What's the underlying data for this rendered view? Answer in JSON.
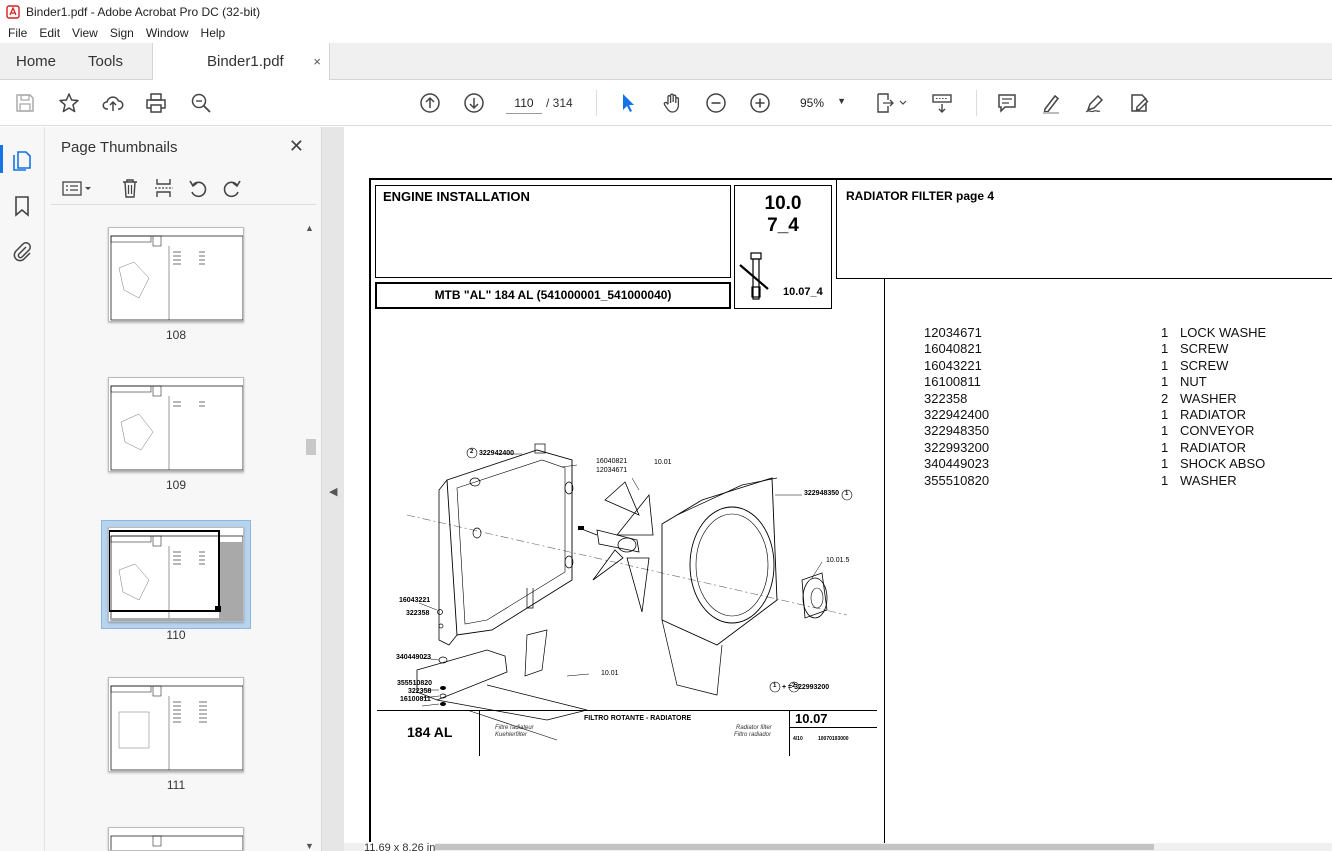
{
  "window": {
    "title": "Binder1.pdf - Adobe Acrobat Pro DC (32-bit)"
  },
  "menu": [
    "File",
    "Edit",
    "View",
    "Sign",
    "Window",
    "Help"
  ],
  "tabs": {
    "home": "Home",
    "tools": "Tools",
    "document": "Binder1.pdf",
    "close_glyph": "×"
  },
  "toolbar": {
    "page_current": "110",
    "page_total": "/ 314",
    "zoom": "95%"
  },
  "thumbnails_panel": {
    "title": "Page Thumbnails",
    "close_glyph": "✕",
    "pages": [
      {
        "label": "108",
        "selected": false
      },
      {
        "label": "109",
        "selected": false
      },
      {
        "label": "110",
        "selected": true
      },
      {
        "label": "111",
        "selected": false
      }
    ]
  },
  "document": {
    "header": {
      "section_title": "ENGINE INSTALLATION",
      "code_top": "10.0",
      "code_bottom": "7_4",
      "code_small": "10.07_4",
      "model_line": "MTB \"AL\" 184 AL (541000001_541000040)",
      "right_title": "RADIATOR FILTER  page 4"
    },
    "parts": [
      {
        "code": "12034671",
        "qty": "1",
        "desc": "LOCK WASHE"
      },
      {
        "code": "16040821",
        "qty": "1",
        "desc": "SCREW"
      },
      {
        "code": "16043221",
        "qty": "1",
        "desc": "SCREW"
      },
      {
        "code": "16100811",
        "qty": "1",
        "desc": "NUT"
      },
      {
        "code": "322358",
        "qty": "2",
        "desc": "WASHER"
      },
      {
        "code": "322942400",
        "qty": "1",
        "desc": "RADIATOR"
      },
      {
        "code": "322948350",
        "qty": "1",
        "desc": "CONVEYOR"
      },
      {
        "code": "322993200",
        "qty": "1",
        "desc": "RADIATOR"
      },
      {
        "code": "340449023",
        "qty": "1",
        "desc": "SHOCK ABSO"
      },
      {
        "code": "355510820",
        "qty": "1",
        "desc": "WASHER"
      }
    ],
    "drawing": {
      "labels": {
        "l_322942400": "322942400",
        "l_16040821": "16040821",
        "l_12034671": "12034671",
        "l_1001a": "10.01",
        "l_322948350": "322948350",
        "l_10015": "10.01.5",
        "l_16043221": "16043221",
        "l_322358a": "322358",
        "l_340449023": "340449023",
        "l_1001b": "10.01",
        "l_355510820": "355510820",
        "l_322358b": "322358",
        "l_16100811": "16100811",
        "l_sum": "+      = 322993200",
        "c1": "1",
        "c2": "2"
      },
      "footer": {
        "model": "184 AL",
        "center_title": "FILTRO ROTANTE - RADIATORE",
        "fr_de_1": "Filtre radiateur",
        "fr_de_2": "Kuehlerfilter",
        "en_es_1": "Radiator filter",
        "en_es_2": "Filtro radiador",
        "code": "10.07",
        "page": "4/10",
        "ref": "10070193000"
      }
    },
    "page_size": "11,69 x 8,26 in"
  },
  "colors": {
    "accent": "#1473e6",
    "selection": "#b7d3ee"
  }
}
